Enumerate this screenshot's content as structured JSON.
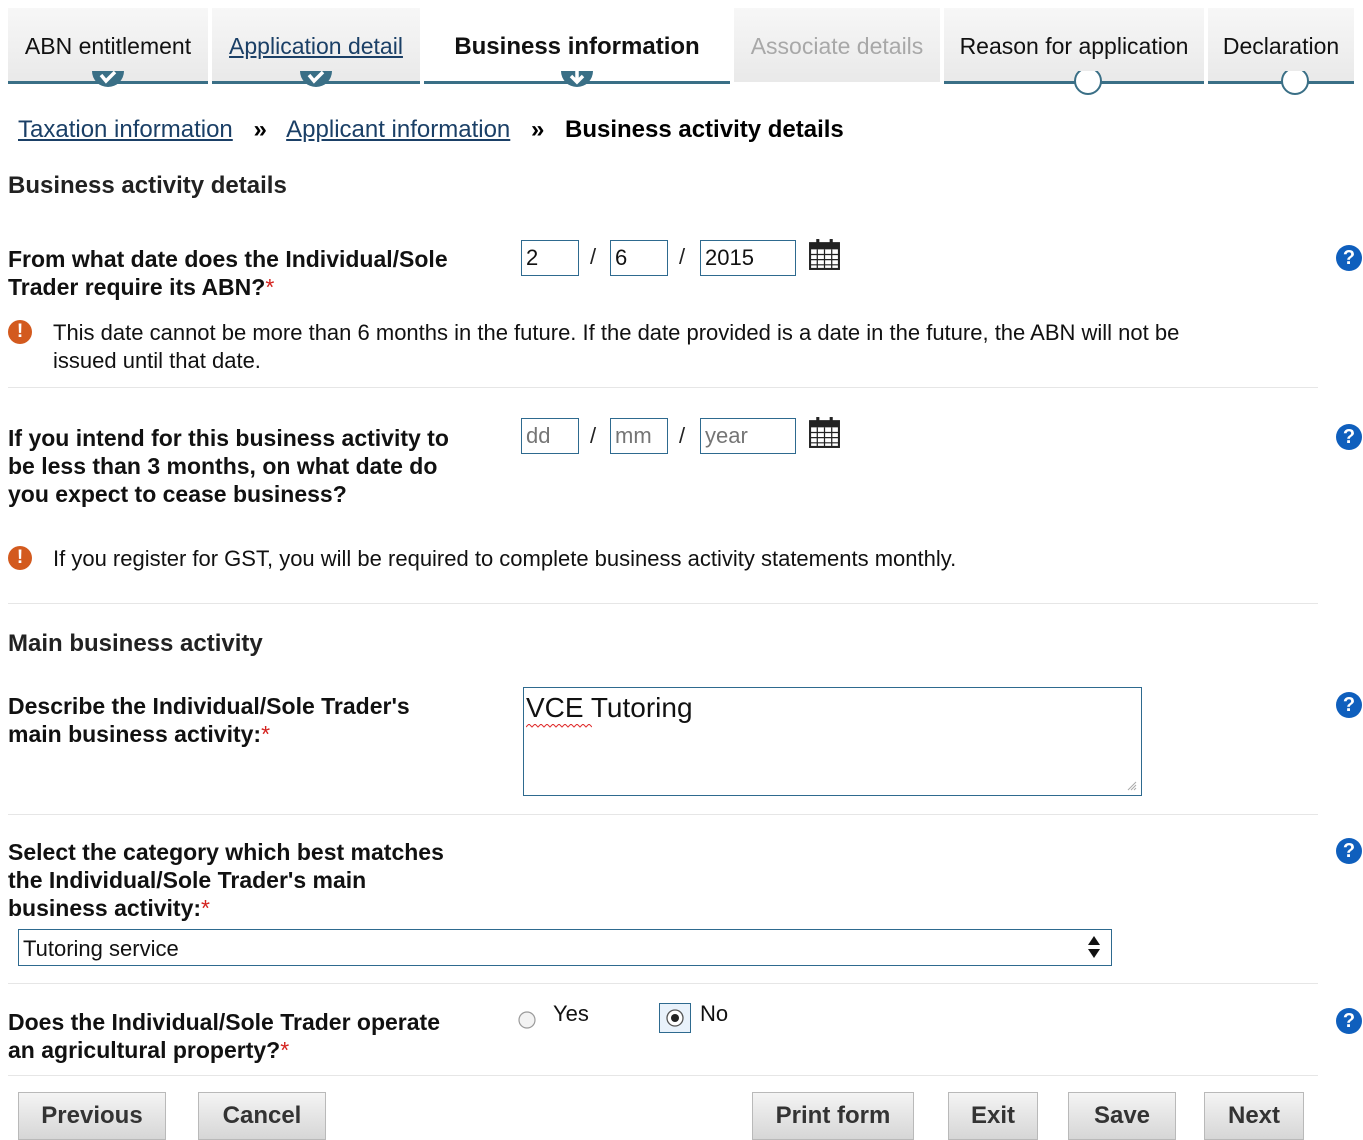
{
  "steps": [
    {
      "label": "ABN entitlement",
      "state": "complete"
    },
    {
      "label": "Application detail",
      "state": "complete"
    },
    {
      "label": "Business information",
      "state": "current"
    },
    {
      "label": "Associate details",
      "state": "disabled"
    },
    {
      "label": "Reason for application",
      "state": "pending"
    },
    {
      "label": "Declaration",
      "state": "pending"
    }
  ],
  "breadcrumb": {
    "item1": "Taxation information",
    "separator": "»",
    "item2": "Applicant information",
    "current": "Business activity details"
  },
  "section1": {
    "heading": "Business activity details",
    "q1": {
      "label_line1": "From what date does the Individual/Sole",
      "label_line2": "Trader require its ABN?",
      "required_mark": "*",
      "day": "2",
      "month": "6",
      "year": "2015",
      "note_line1": "This date cannot be more than 6 months in the future. If the date provided is a date in the future, the ABN will not be",
      "note_line2": "issued until that date."
    },
    "q2": {
      "label_line1": "If you intend for this business activity to",
      "label_line2": "be less than 3 months, on what date do",
      "label_line3": "you expect to cease business?",
      "day_placeholder": "dd",
      "month_placeholder": "mm",
      "year_placeholder": "year",
      "note": "If you register for GST, you will be required to complete business activity statements monthly."
    },
    "date_separator": "/"
  },
  "section2": {
    "heading": "Main business activity",
    "describe": {
      "label_line1": "Describe the Individual/Sole Trader's",
      "label_line2": "main business activity:",
      "required_mark": "*",
      "value": "VCE Tutoring"
    },
    "category": {
      "label_line1": "Select the category which best matches",
      "label_line2": "the Individual/Sole Trader's main",
      "label_line3": "business activity:",
      "required_mark": "*",
      "selected": "Tutoring service"
    },
    "agricultural": {
      "label_line1": "Does the Individual/Sole Trader operate",
      "label_line2": "an agricultural property?",
      "required_mark": "*",
      "yes_label": "Yes",
      "no_label": "No",
      "selected": "No"
    }
  },
  "icons": {
    "help": "?",
    "warning": "!"
  },
  "buttons": {
    "previous": "Previous",
    "cancel": "Cancel",
    "print": "Print form",
    "exit": "Exit",
    "save": "Save",
    "next": "Next"
  },
  "colors": {
    "accent": "#3a6f86",
    "link": "#1a3f66",
    "help": "#0f5fbd",
    "warning": "#d35a1e",
    "required": "#d4231f"
  }
}
